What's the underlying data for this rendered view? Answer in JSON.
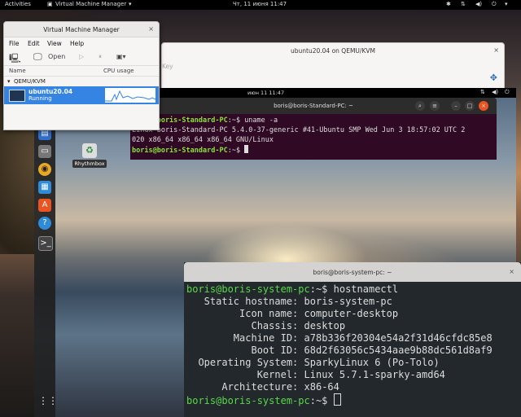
{
  "host_topbar": {
    "activities": "Activities",
    "app_menu": "Virtual Machine Manager",
    "datetime": "Чт, 11 июня  11:47",
    "icons": [
      "accessibility-icon",
      "network-icon",
      "volume-icon",
      "power-icon"
    ]
  },
  "vm_window": {
    "title": "ubuntu20.04 on QEMU/KVM",
    "close": "×",
    "partial_menu": "Key"
  },
  "guest_topbar": {
    "clock": "июн 11  11:47"
  },
  "desktop_icon": {
    "label": "Rhythmbox"
  },
  "guest_terminal": {
    "title": "boris@boris-Standard-PC: ~",
    "lines": [
      {
        "prompt": "boris@boris-Standard-PC",
        "suffix": ":~$ ",
        "cmd": "uname -a"
      },
      {
        "text": "Linux boris-Standard-PC 5.4.0-37-generic #41-Ubuntu SMP Wed Jun 3 18:57:02 UTC 2"
      },
      {
        "text": "020 x86_64 x86_64 x86_64 GNU/Linux"
      },
      {
        "prompt": "boris@boris-Standard-PC",
        "suffix": ":~$ ",
        "cmd": ""
      }
    ]
  },
  "host_terminal": {
    "title": "boris@boris-system-pc: ~",
    "close": "×",
    "prompt": "boris@boris-system-pc",
    "prompt_suffix": ":~$ ",
    "command": "hostnamectl",
    "rows": [
      {
        "key": "   Static hostname:",
        "value": "boris-system-pc"
      },
      {
        "key": "         Icon name:",
        "value": "computer-desktop"
      },
      {
        "key": "           Chassis:",
        "value": "desktop"
      },
      {
        "key": "        Machine ID:",
        "value": "a78b336f20304e54a2f31d46cfdc85e8"
      },
      {
        "key": "           Boot ID:",
        "value": "68d2f63056c5434aae9b88dc561d8af9"
      },
      {
        "key": "  Operating System:",
        "value": "SparkyLinux 6 (Po-Tolo)"
      },
      {
        "key": "            Kernel:",
        "value": "Linux 5.7.1-sparky-amd64"
      },
      {
        "key": "      Architecture:",
        "value": "x86-64"
      }
    ]
  },
  "vmm": {
    "title": "Virtual Machine Manager",
    "menu": {
      "file": "File",
      "edit": "Edit",
      "view": "View",
      "help": "Help"
    },
    "toolbar": {
      "open": "Open"
    },
    "columns": {
      "name": "Name",
      "cpu": "CPU usage"
    },
    "group": "QEMU/KVM",
    "vm": {
      "name": "ubuntu20.04",
      "state": "Running"
    }
  },
  "colors": {
    "guest_prompt": "#8ae234",
    "host_prompt": "#5ad84a",
    "selection": "#3584e4",
    "guest_terminal_bg": "#300a24",
    "host_terminal_bg": "#22282c"
  }
}
